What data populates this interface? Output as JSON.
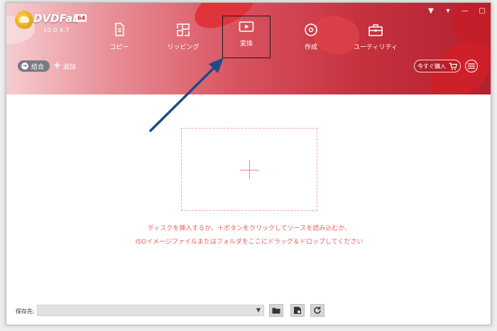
{
  "app": {
    "logo_text": "DVDFab",
    "logo_bits": "64",
    "version": "10.0.9.7"
  },
  "window_controls": [
    "▼",
    "▾",
    "—",
    "▢",
    "✕"
  ],
  "nav_tabs": [
    {
      "label": "コピー",
      "icon": "copy-icon"
    },
    {
      "label": "リッピング",
      "icon": "ripper-icon"
    },
    {
      "label": "変換",
      "icon": "video-convert-icon",
      "active": true
    },
    {
      "label": "作成",
      "icon": "disc-create-icon"
    },
    {
      "label": "ユーティリティ",
      "icon": "toolbox-icon"
    }
  ],
  "toolbar": {
    "merge_label": "結合",
    "add_label": "追加",
    "buy_label": "今すぐ購入"
  },
  "drop_zone": {
    "hint_line1": "ディスクを挿入するか、＋ボタンをクリックしてソースを読み込むか、",
    "hint_line2": "ISOイメージファイルまたはフォルダをここにドラッグ＆ドロップしてください"
  },
  "footer": {
    "save_to_label": "保存先:",
    "save_to_value": ""
  },
  "colors": {
    "accent": "#c7323f",
    "hint": "#e4615f",
    "annotation": "#234a86"
  }
}
